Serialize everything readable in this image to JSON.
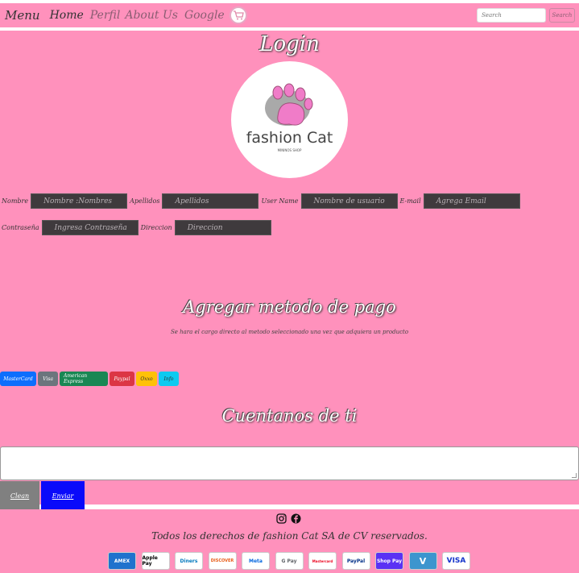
{
  "nav": {
    "brand": "Menu",
    "links": [
      "Home",
      "Perfil",
      "About Us",
      "Google"
    ],
    "search_placeholder": "Search",
    "search_button": "Search"
  },
  "login": {
    "title": "Login",
    "logo_text": "fashion Cat",
    "logo_sub": "MININOS SHOP",
    "fields": [
      {
        "label": "Nombre",
        "placeholder": "Nombre :Nombres"
      },
      {
        "label": "Apellidos",
        "placeholder": "Apellidos"
      },
      {
        "label": "User Name",
        "placeholder": "Nombre de usuario"
      },
      {
        "label": "E-mail",
        "placeholder": "Agrega Email"
      },
      {
        "label": "Contraseña",
        "placeholder": "Ingresa Contraseña"
      },
      {
        "label": "Direccion",
        "placeholder": "Direccion"
      }
    ]
  },
  "payment": {
    "title": "Agregar metodo de pago",
    "subtitle": "Se hara el cargo directo al metodo seleccionado una vez que adquiera un producto",
    "buttons": [
      {
        "label": "MasterCard",
        "color": "#0d6efd"
      },
      {
        "label": "Visa",
        "color": "#6c757d"
      },
      {
        "label": "American Express",
        "color": "#198754"
      },
      {
        "label": "Paypal",
        "color": "#dc3545"
      },
      {
        "label": "Oxxo",
        "color": "#ffc107"
      },
      {
        "label": "Info",
        "color": "#0dcaf0"
      }
    ]
  },
  "feedback": {
    "title": "Cuentanos de ti",
    "clean_label": "Clean",
    "send_label": "Enviar"
  },
  "footer": {
    "rights": "Todos los derechos de fashion Cat SA de CV reservados.",
    "social_icons": [
      "instagram-icon",
      "facebook-icon"
    ],
    "cards": [
      "AMEX",
      "Apple Pay",
      "Diners",
      "DISCOVER",
      "Meta",
      "G Pay",
      "Mastercard",
      "PayPal",
      "Shop Pay",
      "V",
      "VISA"
    ]
  },
  "colors": {
    "background": "#ff91bc",
    "field_bg": "#3f3a3d",
    "send_button": "#0a0afa",
    "clean_button": "#808080"
  }
}
